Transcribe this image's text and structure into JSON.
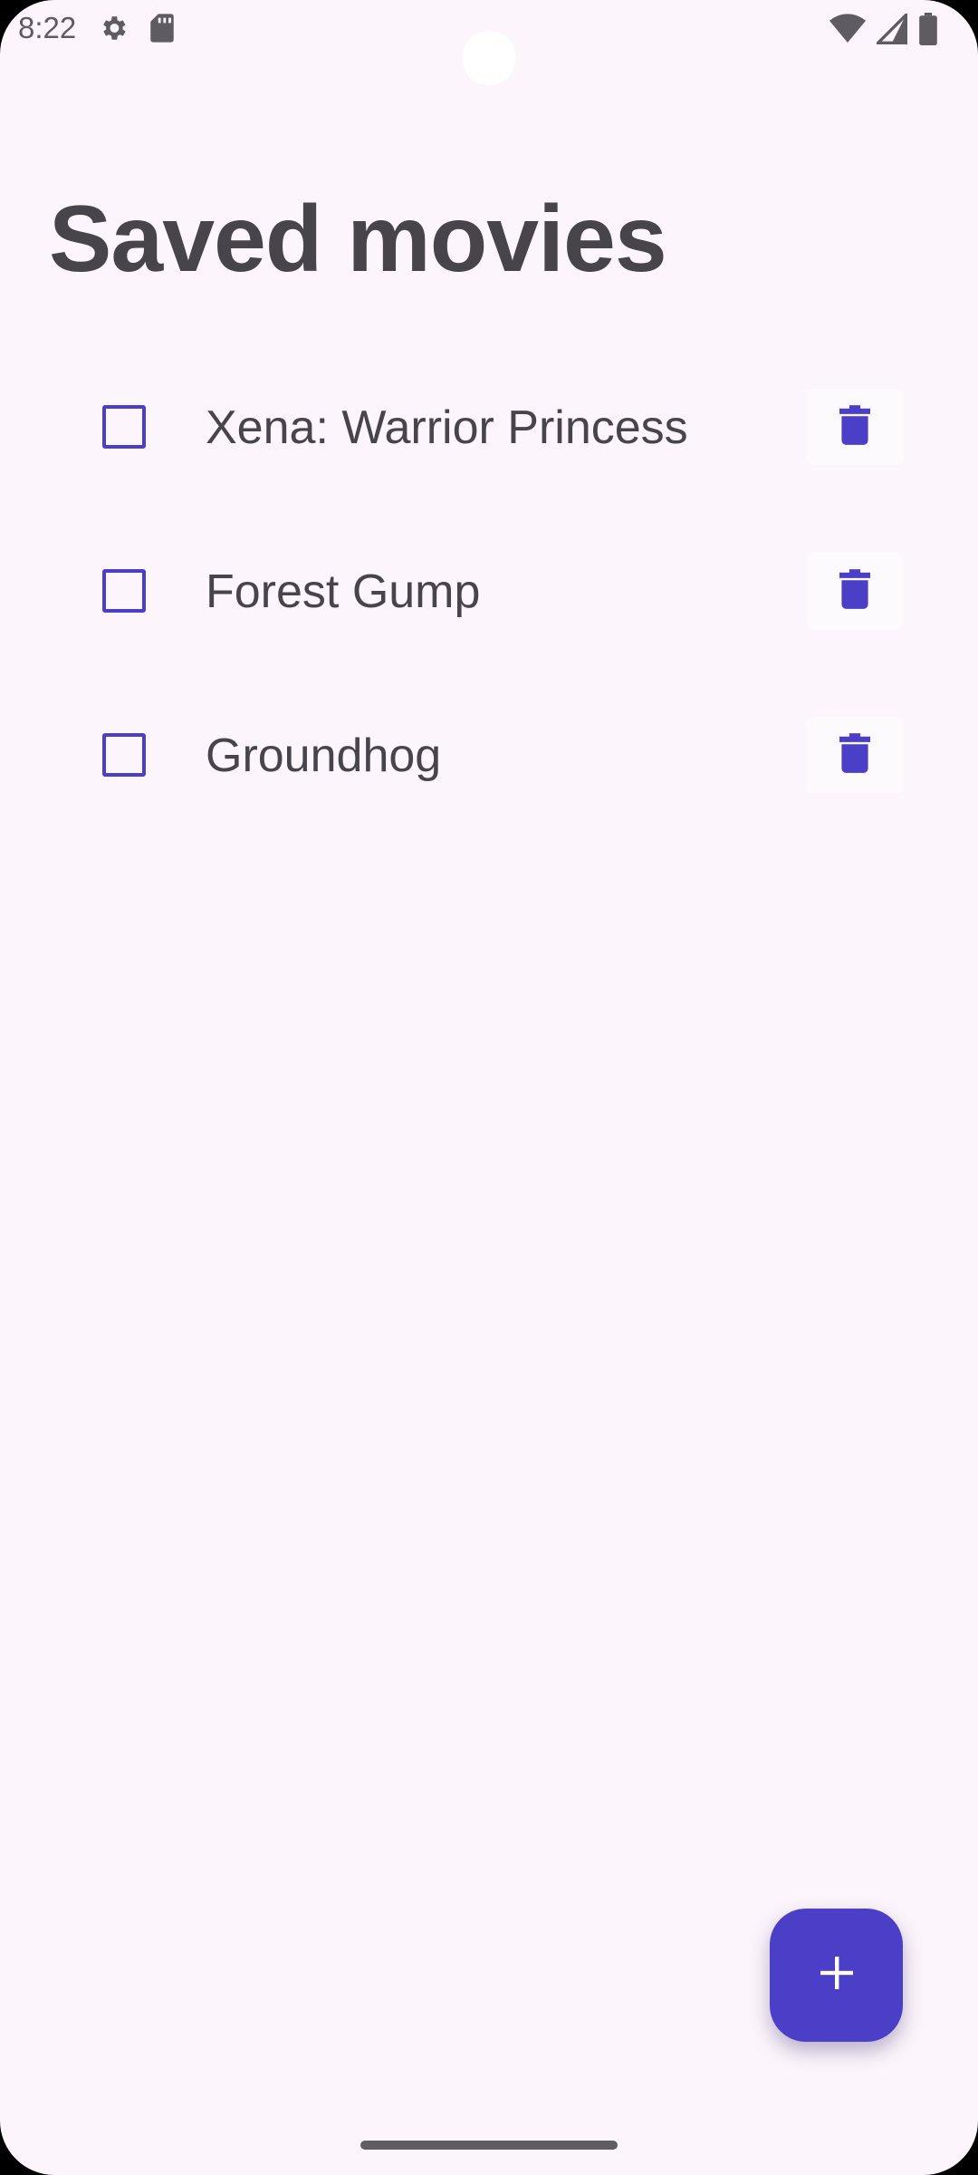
{
  "status_bar": {
    "time": "8:22",
    "icons": [
      "gear-icon",
      "sd-card-icon",
      "wifi-icon",
      "signal-icon",
      "battery-icon"
    ]
  },
  "page": {
    "title": "Saved movies"
  },
  "movies": [
    {
      "title": "Xena: Warrior Princess",
      "checked": false
    },
    {
      "title": "Forest Gump",
      "checked": false
    },
    {
      "title": "Groundhog",
      "checked": false
    }
  ],
  "fab": {
    "icon": "plus-icon"
  },
  "colors": {
    "background": "#fcf5fb",
    "accent": "#4a3fc6",
    "text": "#47444c"
  }
}
